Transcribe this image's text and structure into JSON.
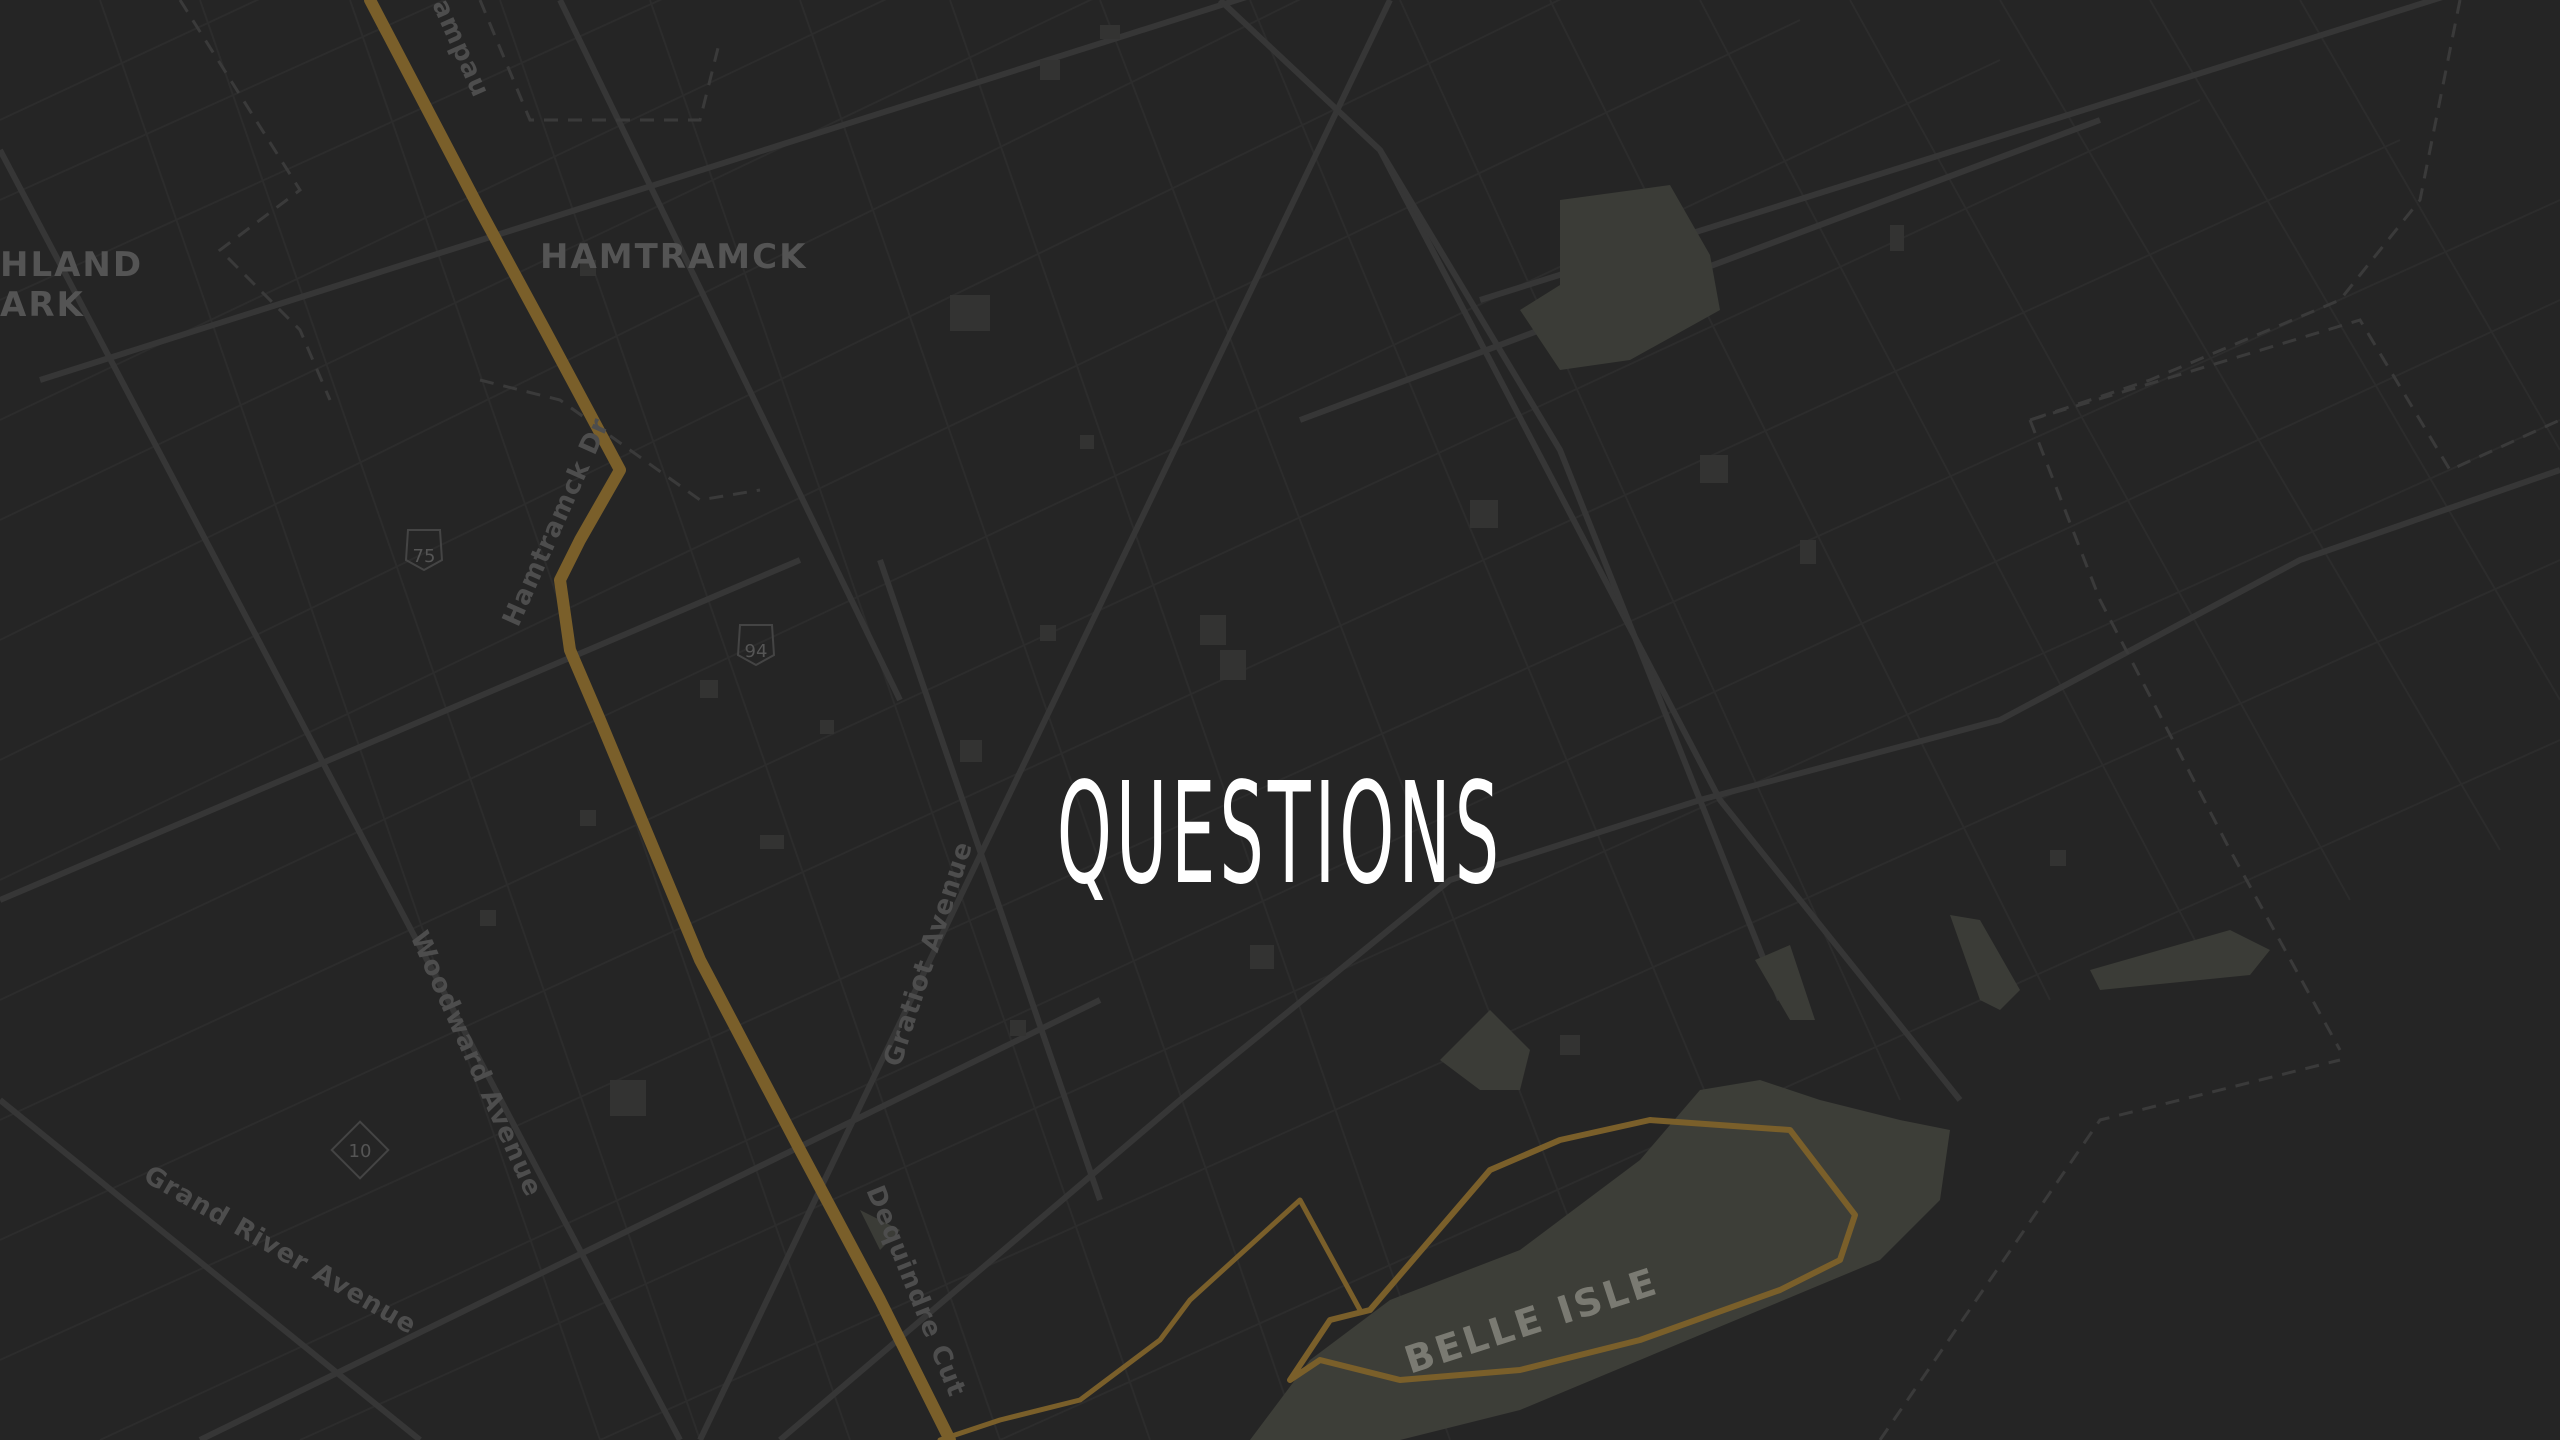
{
  "slide": {
    "title": "QUESTIONS"
  },
  "map": {
    "labels": {
      "hamtramck": "HAMTRAMCK",
      "highland_park_line1": "HLAND",
      "highland_park_line2": "ARK",
      "belle_isle": "BELLE ISLE",
      "hamtramck_dr": "Hamtramck Dr",
      "gratiot_avenue": "Gratiot Avenue",
      "woodward_avenue": "Woodward Avenue",
      "grand_river_avenue": "Grand River Avenue",
      "dequindre_cut": "Dequindre Cut",
      "campau": "ampau"
    },
    "shields": {
      "i75": "75",
      "i94": "94",
      "m10": "10"
    },
    "colors": {
      "background": "#252525",
      "roads": "#333333",
      "major_roads": "#393939",
      "park": "#3f403a",
      "route": "#7a5f2a",
      "labels": "#545454"
    }
  }
}
